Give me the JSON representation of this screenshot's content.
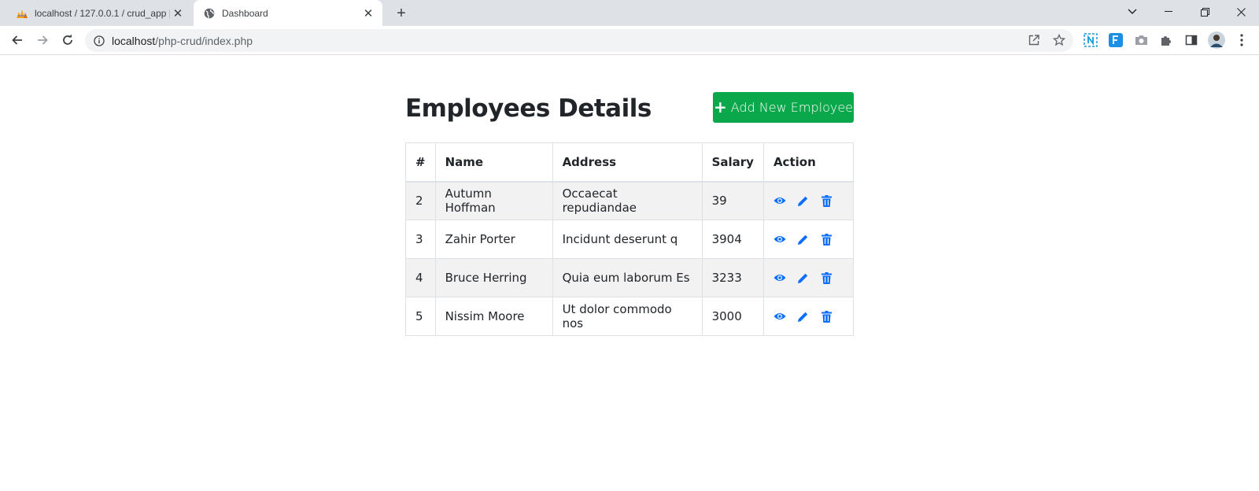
{
  "browser": {
    "tabs": [
      {
        "title": "localhost / 127.0.0.1 / crud_app |",
        "active": false,
        "icon": "phpmyadmin-icon"
      },
      {
        "title": "Dashboard",
        "active": true,
        "icon": "globe-icon"
      }
    ],
    "url": {
      "host": "localhost",
      "path": "/php-crud/index.php"
    },
    "extensions": [
      "n-extension-icon",
      "f-extension-icon",
      "camera-icon",
      "puzzle-icon",
      "side-panel-icon",
      "profile-avatar"
    ]
  },
  "page": {
    "title": "Employees Details",
    "add_button_label": "Add New Employee",
    "accent_color": "#0aa74b",
    "action_icon_color": "#0d6efd"
  },
  "table": {
    "headers": [
      "#",
      "Name",
      "Address",
      "Salary",
      "Action"
    ],
    "rows": [
      {
        "id": "2",
        "name": "Autumn Hoffman",
        "address": "Occaecat repudiandae",
        "salary": "39"
      },
      {
        "id": "3",
        "name": "Zahir Porter",
        "address": "Incidunt deserunt q",
        "salary": "3904"
      },
      {
        "id": "4",
        "name": "Bruce Herring",
        "address": "Quia eum laborum Es",
        "salary": "3233"
      },
      {
        "id": "5",
        "name": "Nissim Moore",
        "address": "Ut dolor commodo nos",
        "salary": "3000"
      }
    ]
  }
}
